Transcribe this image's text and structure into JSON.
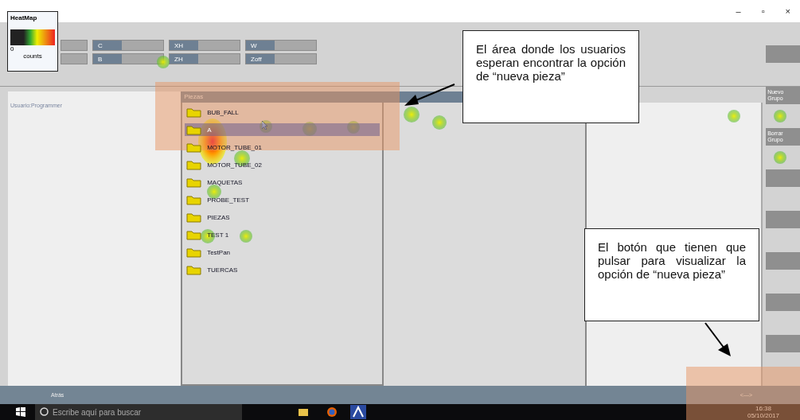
{
  "window": {
    "controls": [
      "–",
      "▫",
      "×"
    ]
  },
  "legend": {
    "title": "HeatMap",
    "min": "0",
    "unit": "counts"
  },
  "toolbar": {
    "fields": [
      {
        "label": "C"
      },
      {
        "label": "XH"
      },
      {
        "label": "W"
      },
      {
        "label": "B"
      },
      {
        "label": "ZH"
      },
      {
        "label": "Zoff"
      }
    ]
  },
  "user_label": "Usuario:Programmer",
  "pieces": {
    "title": "Piezas",
    "items": [
      {
        "label": "BUB_FALL",
        "selected": false
      },
      {
        "label": "A",
        "selected": true
      },
      {
        "label": "MOTOR_TUBE_01",
        "selected": false
      },
      {
        "label": "MOTOR_TUBE_02",
        "selected": false
      },
      {
        "label": "MAQUETAS",
        "selected": false
      },
      {
        "label": "PROBE_TEST",
        "selected": false
      },
      {
        "label": "PIEZAS",
        "selected": false
      },
      {
        "label": "TEST 1",
        "selected": false
      },
      {
        "label": "TestPan",
        "selected": false
      },
      {
        "label": "TUERCAS",
        "selected": false
      }
    ]
  },
  "side_buttons": [
    {
      "kind": "blank"
    },
    {
      "kind": "labeled",
      "label": "Nuevo Grupo"
    },
    {
      "kind": "labeled",
      "label": "Borrar Grupo"
    },
    {
      "kind": "blank"
    },
    {
      "kind": "blank"
    },
    {
      "kind": "blank"
    },
    {
      "kind": "blank"
    },
    {
      "kind": "blank"
    }
  ],
  "bottom_bar": {
    "back": "Atrás",
    "arrows": "<—>"
  },
  "taskbar": {
    "search_placeholder": "Escribe aquí para buscar",
    "time": "16:38",
    "date": "05/10/2017"
  },
  "annotations": [
    {
      "text": "El área donde los usuarios esperan encontrar la opción de “nueva pieza”"
    },
    {
      "text": "El botón que tienen que pulsar para visualizar la opción de “nueva pieza”"
    }
  ]
}
